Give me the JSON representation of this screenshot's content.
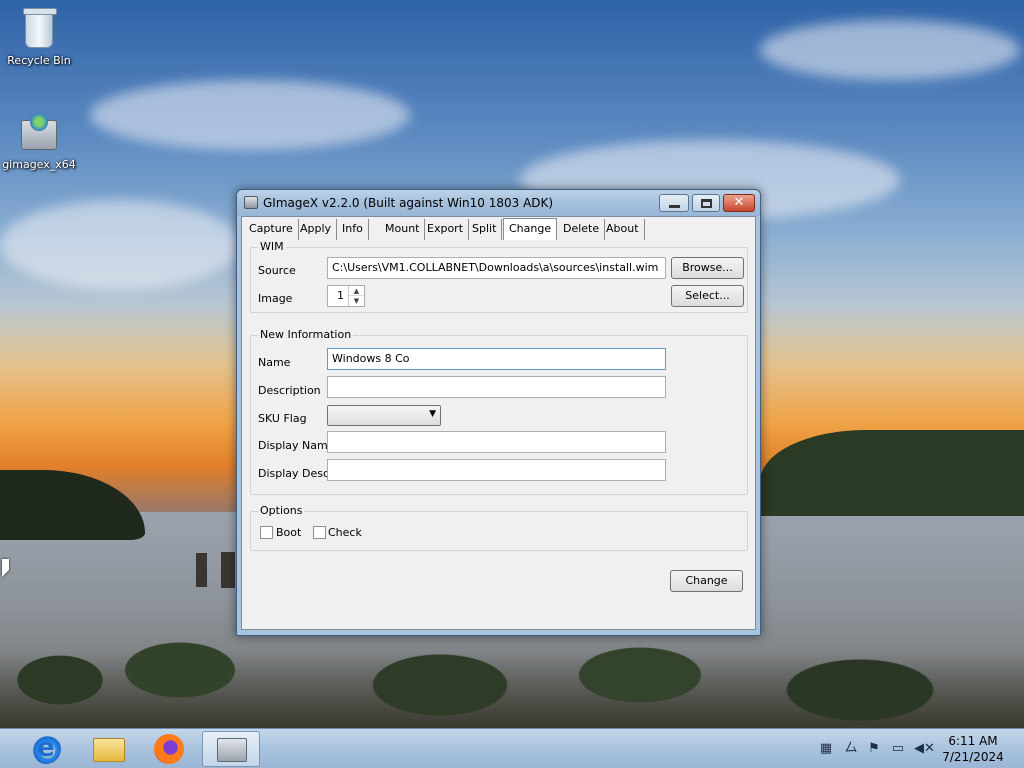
{
  "desktop": {
    "icons": [
      {
        "label": "Recycle Bin",
        "icon": "recycle-bin-icon"
      },
      {
        "label": "gimagex_x64",
        "icon": "gimagex-icon"
      }
    ]
  },
  "window": {
    "title": "GImageX v2.2.0 (Built against Win10 1803 ADK)",
    "controls": {
      "minimize": "minimize-icon",
      "maximize": "maximize-icon",
      "close": "✕"
    },
    "tabs": [
      {
        "label": "Capture"
      },
      {
        "label": "Apply"
      },
      {
        "label": "Info"
      },
      {
        "label": "Mount"
      },
      {
        "label": "Export"
      },
      {
        "label": "Split"
      },
      {
        "label": "Change",
        "active": true
      },
      {
        "label": "Delete"
      },
      {
        "label": "About"
      }
    ],
    "wim": {
      "group_label": "WIM",
      "source_label": "Source",
      "source_value": "C:\\Users\\VM1.COLLABNET\\Downloads\\a\\sources\\install.wim",
      "browse_label": "Browse...",
      "image_label": "Image",
      "image_value": "1",
      "select_label": "Select..."
    },
    "new_info": {
      "group_label": "New Information",
      "name_label": "Name",
      "name_value": "Windows 8 Co",
      "description_label": "Description",
      "description_value": "",
      "sku_label": "SKU Flag",
      "sku_value": "",
      "display_name_label": "Display Name",
      "display_name_value": "",
      "display_desc_label": "Display Desc.",
      "display_desc_value": ""
    },
    "options": {
      "group_label": "Options",
      "boot_label": "Boot",
      "boot_checked": false,
      "check_label": "Check",
      "check_checked": false
    },
    "change_button": "Change"
  },
  "taskbar": {
    "apps": [
      {
        "name": "internet-explorer",
        "icon": "internet-explorer-icon"
      },
      {
        "name": "file-explorer",
        "icon": "folder-icon"
      },
      {
        "name": "firefox",
        "icon": "firefox-icon"
      },
      {
        "name": "gimagex",
        "icon": "gimagex-icon",
        "active": true
      }
    ],
    "tray": [
      "network-icon",
      "ime-icon",
      "flag-icon",
      "display-icon",
      "volume-muted-icon"
    ],
    "clock": {
      "time": "6:11 AM",
      "date": "7/21/2024"
    }
  }
}
